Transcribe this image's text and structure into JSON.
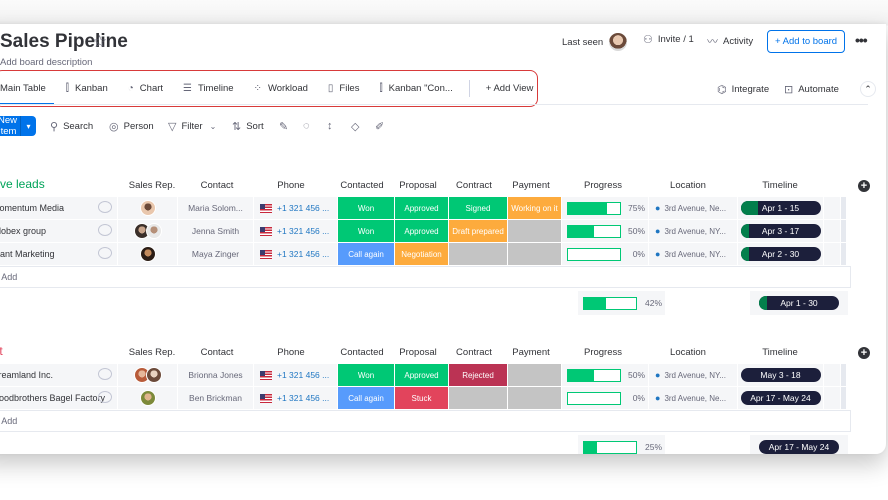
{
  "board": {
    "title": "Sales Pipeline",
    "description": "Add board description"
  },
  "header": {
    "last_seen_label": "Last seen",
    "invite_label": "Invite / 1",
    "activity_label": "Activity",
    "add_to_board_label": "+ Add to board",
    "more_label": "•••"
  },
  "views": {
    "tabs": [
      {
        "label": "Main Table",
        "icon": "home-icon",
        "active": true
      },
      {
        "label": "Kanban",
        "icon": "kanban-icon"
      },
      {
        "label": "Chart",
        "icon": "chart-icon"
      },
      {
        "label": "Timeline",
        "icon": "timeline-icon"
      },
      {
        "label": "Workload",
        "icon": "workload-icon"
      },
      {
        "label": "Files",
        "icon": "file-icon"
      },
      {
        "label": "Kanban \"Con...",
        "icon": "kanban-icon"
      }
    ],
    "add_view_label": "+ Add View",
    "integrate_label": "Integrate",
    "automate_label": "Automate"
  },
  "toolbar": {
    "new_item_label": "New Item",
    "search_label": "Search",
    "person_label": "Person",
    "filter_label": "Filter",
    "sort_label": "Sort"
  },
  "columns": [
    "Sales Rep.",
    "Contact",
    "Phone",
    "Contacted",
    "Proposal",
    "Contract",
    "Payment",
    "Progress",
    "Location",
    "Timeline"
  ],
  "colors": {
    "won": "#00c875",
    "approved": "#00c875",
    "signed": "#00c875",
    "working": "#fdab3d",
    "draft": "#fdab3d",
    "negotiation": "#fdab3d",
    "call_again": "#579bfc",
    "rejected": "#bb3354",
    "stuck": "#e2445c",
    "empty": "#c4c4c4",
    "group_active": "#037f4c",
    "group_lost": "#e2445c",
    "accent": "#0073ea"
  },
  "groups": [
    {
      "title": "Active leads",
      "color": "#00a359",
      "rows": [
        {
          "name": "Momentum Media",
          "contact": "Maria Solom...",
          "phone": "+1 321 456 ...",
          "contacted": "Won",
          "proposal": "Approved",
          "contract": "Signed",
          "payment": "Working on it",
          "progress": 75,
          "progress_label": "75%",
          "location": "3rd Avenue, Ne...",
          "timeline": "Apr 1 - 15",
          "timeline_elapsed": 0.22
        },
        {
          "name": "Globex group",
          "contact": "Jenna Smith",
          "phone": "+1 321 456 ...",
          "contacted": "Won",
          "proposal": "Approved",
          "contract": "Draft prepared",
          "payment": "",
          "progress": 50,
          "progress_label": "50%",
          "location": "3rd Avenue, NY...",
          "timeline": "Apr 3 - 17",
          "timeline_elapsed": 0.1
        },
        {
          "name": "Vlant Marketing",
          "contact": "Maya Zinger",
          "phone": "+1 321 456 ...",
          "contacted": "Call again",
          "proposal": "Negotiation",
          "contract": "",
          "payment": "",
          "progress": 0,
          "progress_label": "0%",
          "location": "3rd Avenue, NY...",
          "timeline": "Apr 2 - 30",
          "timeline_elapsed": 0.1
        }
      ],
      "add_label": "+ Add",
      "summary_progress": 42,
      "summary_progress_label": "42%",
      "summary_timeline": "Apr 1 - 30",
      "summary_timeline_elapsed": 0.1
    },
    {
      "title": "Lost",
      "color": "#e2445c",
      "rows": [
        {
          "name": "Dreamland Inc.",
          "contact": "Brionna Jones",
          "phone": "+1 321 456 ...",
          "contacted": "Won",
          "proposal": "Approved",
          "contract": "Rejected",
          "payment": "",
          "progress": 50,
          "progress_label": "50%",
          "location": "3rd Avenue, NY...",
          "timeline": "May 3 - 18",
          "timeline_elapsed": 0
        },
        {
          "name": "Goodbrothers Bagel Factory",
          "contact": "Ben Brickman",
          "phone": "+1 321 456 ...",
          "contacted": "Call again",
          "proposal": "Stuck",
          "contract": "",
          "payment": "",
          "progress": 0,
          "progress_label": "0%",
          "location": "3rd Avenue, Ne...",
          "timeline": "Apr 17 - May 24",
          "timeline_elapsed": 0
        }
      ],
      "add_label": "+ Add",
      "summary_progress": 25,
      "summary_progress_label": "25%",
      "summary_timeline": "Apr 17 - May 24",
      "summary_timeline_elapsed": 0
    }
  ]
}
